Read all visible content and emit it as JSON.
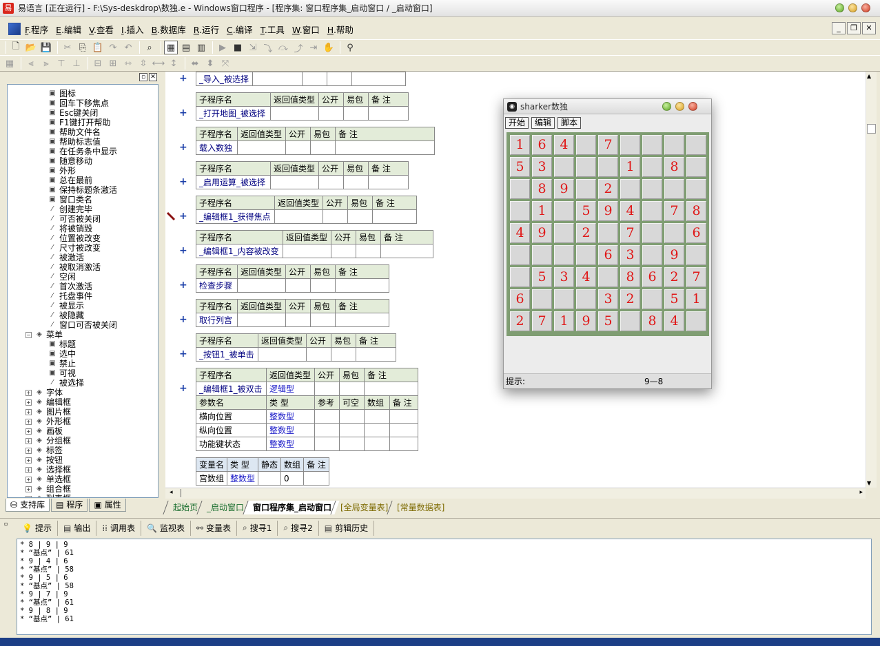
{
  "window": {
    "title": "易语言 [正在运行] - F:\\Sys-deskdrop\\数独.e - Windows窗口程序 - [程序集: 窗口程序集_启动窗口 / _启动窗口]"
  },
  "menu": [
    {
      "key": "F",
      "label": ".程序"
    },
    {
      "key": "E",
      "label": ".编辑"
    },
    {
      "key": "V",
      "label": ".查看"
    },
    {
      "key": "I",
      "label": ".插入"
    },
    {
      "key": "B",
      "label": ".数据库"
    },
    {
      "key": "R",
      "label": ".运行"
    },
    {
      "key": "C",
      "label": ".编译"
    },
    {
      "key": "T",
      "label": ".工具"
    },
    {
      "key": "W",
      "label": ".窗口"
    },
    {
      "key": "H",
      "label": ".帮助"
    }
  ],
  "tree": {
    "items": [
      {
        "label": "图标",
        "kind": "prop"
      },
      {
        "label": "回车下移焦点",
        "kind": "prop"
      },
      {
        "label": "Esc键关闭",
        "kind": "prop"
      },
      {
        "label": "F1键打开帮助",
        "kind": "prop"
      },
      {
        "label": "帮助文件名",
        "kind": "prop"
      },
      {
        "label": "帮助标志值",
        "kind": "prop"
      },
      {
        "label": "在任务条中显示",
        "kind": "prop"
      },
      {
        "label": "随意移动",
        "kind": "prop"
      },
      {
        "label": "外形",
        "kind": "prop"
      },
      {
        "label": "总在最前",
        "kind": "prop"
      },
      {
        "label": "保持标题条激活",
        "kind": "prop"
      },
      {
        "label": "窗口类名",
        "kind": "prop"
      },
      {
        "label": "创建完毕",
        "kind": "event"
      },
      {
        "label": "可否被关闭",
        "kind": "event"
      },
      {
        "label": "将被销毁",
        "kind": "event"
      },
      {
        "label": "位置被改变",
        "kind": "event"
      },
      {
        "label": "尺寸被改变",
        "kind": "event"
      },
      {
        "label": "被激活",
        "kind": "event"
      },
      {
        "label": "被取消激活",
        "kind": "event"
      },
      {
        "label": "空闲",
        "kind": "event"
      },
      {
        "label": "首次激活",
        "kind": "event"
      },
      {
        "label": "托盘事件",
        "kind": "event"
      },
      {
        "label": "被显示",
        "kind": "event"
      },
      {
        "label": "被隐藏",
        "kind": "event"
      },
      {
        "label": "窗口可否被关闭",
        "kind": "event"
      },
      {
        "label": "菜单",
        "kind": "group-open"
      },
      {
        "label": "标题",
        "kind": "prop"
      },
      {
        "label": "选中",
        "kind": "prop"
      },
      {
        "label": "禁止",
        "kind": "prop"
      },
      {
        "label": "可视",
        "kind": "prop"
      },
      {
        "label": "被选择",
        "kind": "event"
      },
      {
        "label": "字体",
        "kind": "group"
      },
      {
        "label": "编辑框",
        "kind": "group"
      },
      {
        "label": "图片框",
        "kind": "group"
      },
      {
        "label": "外形框",
        "kind": "group"
      },
      {
        "label": "画板",
        "kind": "group"
      },
      {
        "label": "分组框",
        "kind": "group"
      },
      {
        "label": "标签",
        "kind": "group"
      },
      {
        "label": "按钮",
        "kind": "group"
      },
      {
        "label": "选择框",
        "kind": "group"
      },
      {
        "label": "单选框",
        "kind": "group"
      },
      {
        "label": "组合框",
        "kind": "group"
      },
      {
        "label": "列表框",
        "kind": "group"
      }
    ]
  },
  "left_tabs": [
    "支持库",
    "程序",
    "属性"
  ],
  "editor": {
    "top_row": "_导入_被选择",
    "header": {
      "name": "子程序名",
      "ret": "返回值类型",
      "pub": "公开",
      "easy": "易包",
      "note": "备 注"
    },
    "subs": [
      {
        "name": "_打开地图_被选择"
      },
      {
        "name": "载入数独"
      },
      {
        "name": "_启用运算_被选择"
      },
      {
        "name": "_编辑框1_获得焦点"
      },
      {
        "name": "_编辑框1_内容被改变"
      },
      {
        "name": "检查步骤"
      },
      {
        "name": "取行列宫"
      },
      {
        "name": "_按钮1_被单击"
      },
      {
        "name": "_编辑框1_被双击",
        "ret": "逻辑型"
      }
    ],
    "param_header": {
      "name": "参数名",
      "type": "类 型",
      "ref": "参考",
      "nullable": "可空",
      "arr": "数组",
      "note": "备 注"
    },
    "params": [
      {
        "name": "横向位置",
        "type": "整数型"
      },
      {
        "name": "纵向位置",
        "type": "整数型"
      },
      {
        "name": "功能键状态",
        "type": "整数型"
      }
    ],
    "var_header": {
      "name": "变量名",
      "type": "类 型",
      "static": "静态",
      "arr": "数组",
      "note": "备 注"
    },
    "vars": [
      {
        "name": "宫数组",
        "type": "整数型",
        "arr": "0"
      }
    ]
  },
  "editor_tabs": [
    "起始页",
    "_启动窗口",
    "窗口程序集_启动窗口",
    "[全局变量表]",
    "[常量数据表]"
  ],
  "bottom_tabs": [
    "提示",
    "输出",
    "调用表",
    "监视表",
    "变量表",
    "搜寻1",
    "搜寻2",
    "剪辑历史"
  ],
  "output_lines": [
    "* 8 | 9 | 9",
    "* “基点” | 61",
    "* 9 | 4 | 6",
    "* “基点” | 58",
    "* 9 | 5 | 6",
    "* “基点” | 58",
    "* 9 | 7 | 9",
    "* “基点” | 61",
    "* 9 | 8 | 9",
    "* “基点” | 61"
  ],
  "sudoku": {
    "title": "sharker数独",
    "buttons": [
      "开始",
      "编辑",
      "脚本"
    ],
    "grid": [
      [
        "1",
        "6",
        "4",
        "",
        "7",
        "",
        "",
        "",
        ""
      ],
      [
        "5",
        "3",
        "",
        "",
        "",
        "1",
        "",
        "8",
        ""
      ],
      [
        "",
        "8",
        "9",
        "",
        "2",
        "",
        "",
        "",
        ""
      ],
      [
        "",
        "1",
        "",
        "5",
        "9",
        "4",
        "",
        "7",
        "8"
      ],
      [
        "4",
        "9",
        "",
        "2",
        "",
        "7",
        "",
        "",
        "6"
      ],
      [
        "",
        "",
        "",
        "",
        "6",
        "3",
        "",
        "9",
        ""
      ],
      [
        "",
        "5",
        "3",
        "4",
        "",
        "8",
        "6",
        "2",
        "7"
      ],
      [
        "6",
        "",
        "",
        "",
        "3",
        "2",
        "",
        "5",
        "1"
      ],
      [
        "2",
        "7",
        "1",
        "9",
        "5",
        "",
        "8",
        "4",
        ""
      ]
    ],
    "status_label": "提示:",
    "status_value": "9—8"
  }
}
